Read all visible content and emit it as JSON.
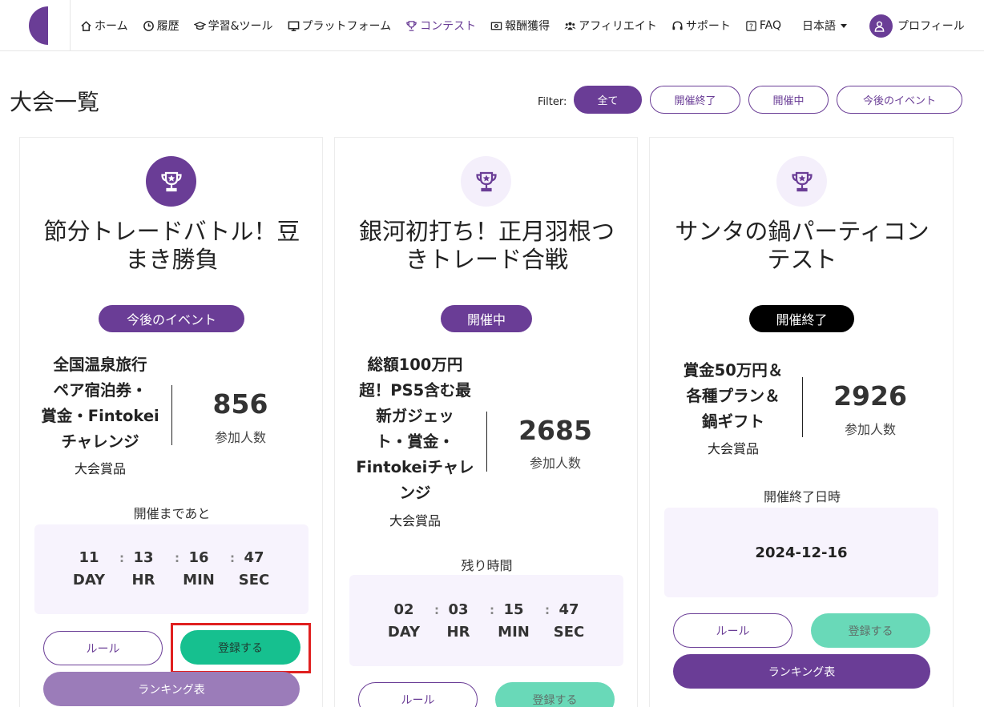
{
  "nav": {
    "items": [
      {
        "label": "ホーム",
        "icon": "home-icon"
      },
      {
        "label": "履歴",
        "icon": "clock-icon"
      },
      {
        "label": "学習&ツール",
        "icon": "graduation-cap-icon"
      },
      {
        "label": "プラットフォーム",
        "icon": "monitor-icon"
      },
      {
        "label": "コンテスト",
        "icon": "trophy-icon",
        "active": true
      },
      {
        "label": "報酬獲得",
        "icon": "money-icon"
      },
      {
        "label": "アフィリエイト",
        "icon": "users-icon"
      },
      {
        "label": "サポート",
        "icon": "headset-icon"
      },
      {
        "label": "FAQ",
        "icon": "question-icon"
      }
    ],
    "language": "日本語",
    "profile": "プロフィール"
  },
  "page": {
    "title": "大会一覧",
    "filter_label": "Filter:",
    "filters": [
      "全て",
      "開催終了",
      "開催中",
      "今後のイベント"
    ],
    "active_filter": "全て"
  },
  "cards": [
    {
      "title_lines": [
        "節分トレードバトル！豆",
        "まき勝負"
      ],
      "status": "今後のイベント",
      "prize_lines": [
        "全国温泉旅行",
        "ペア宿泊券・",
        "賞金・Fintokei",
        "チャレンジ"
      ],
      "prize_label": "大会賞品",
      "participants": "856",
      "participants_label": "参加人数",
      "countdown_label": "開催まであと",
      "countdown": {
        "day": "11",
        "hr": "13",
        "min": "16",
        "sec": "47"
      },
      "units": {
        "day": "DAY",
        "hr": "HR",
        "min": "MIN",
        "sec": "SEC"
      },
      "rules_button": "ルール",
      "register_button": "登録する",
      "ranking_button": "ランキング表"
    },
    {
      "title_lines": [
        "銀河初打ち！正月羽根つ",
        "きトレード合戦"
      ],
      "status": "開催中",
      "prize_lines": [
        "総額100万円",
        "超！PS5含む最",
        "新ガジェッ",
        "ト・賞金・",
        "Fintokeiチャレ",
        "ンジ"
      ],
      "prize_label": "大会賞品",
      "participants": "2685",
      "participants_label": "参加人数",
      "countdown_label": "残り時間",
      "countdown": {
        "day": "02",
        "hr": "03",
        "min": "15",
        "sec": "47"
      },
      "units": {
        "day": "DAY",
        "hr": "HR",
        "min": "MIN",
        "sec": "SEC"
      },
      "rules_button": "ルール",
      "register_button": "登録する"
    },
    {
      "title_lines": [
        "サンタの鍋パーティコン",
        "テスト"
      ],
      "status": "開催終了",
      "prize_lines": [
        "賞金50万円＆",
        "各種プラン＆",
        "鍋ギフト"
      ],
      "prize_label": "大会賞品",
      "participants": "2926",
      "participants_label": "参加人数",
      "end_label": "開催終了日時",
      "end_date": "2024-12-16",
      "rules_button": "ルール",
      "register_button": "登録する",
      "ranking_button": "ランキング表"
    }
  ],
  "colors": {
    "brand": "#6a3d96",
    "green": "#16c08f",
    "highlight": "#e02020"
  }
}
